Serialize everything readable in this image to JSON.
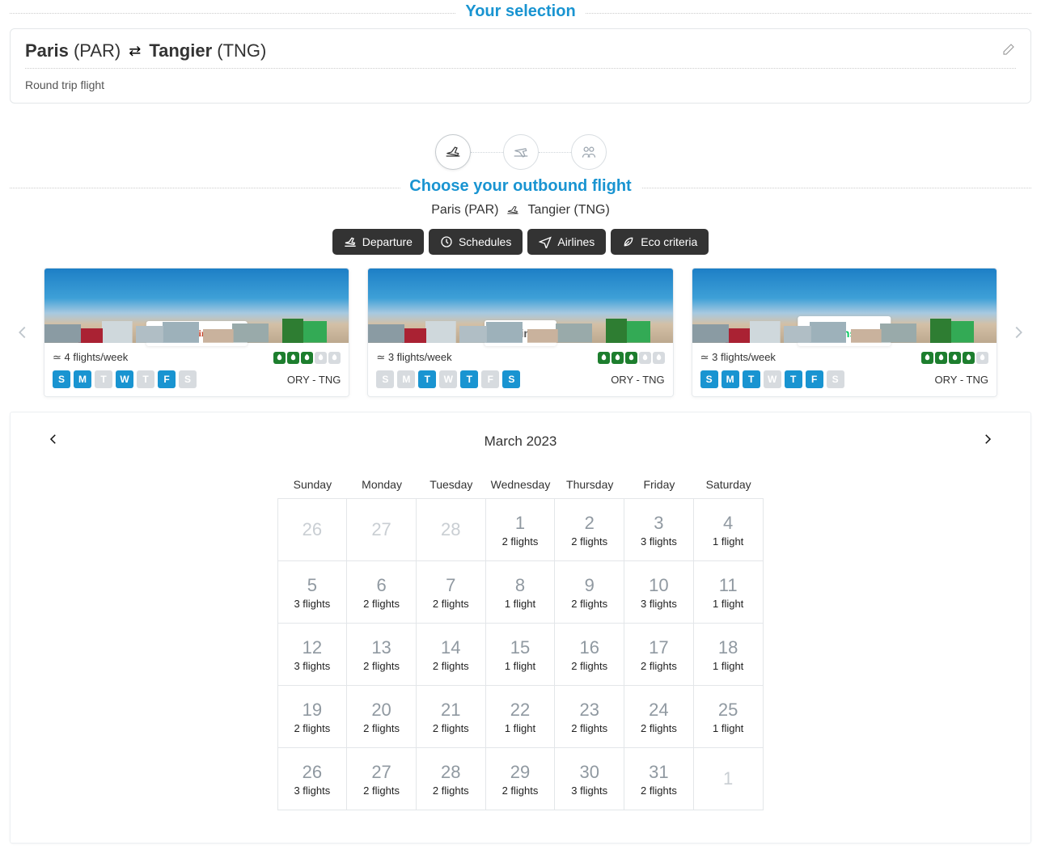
{
  "selection": {
    "title": "Your selection",
    "from_city": "Paris",
    "from_code": "(PAR)",
    "to_city": "Tangier",
    "to_code": "(TNG)",
    "trip_type": "Round trip flight"
  },
  "steps": {
    "active": 0
  },
  "outbound": {
    "title": "Choose your outbound flight",
    "from": "Paris (PAR)",
    "to": "Tangier (TNG)"
  },
  "filters": {
    "departure": "Departure",
    "schedules": "Schedules",
    "airlines": "Airlines",
    "eco": "Eco criteria"
  },
  "day_labels": [
    "S",
    "M",
    "T",
    "W",
    "T",
    "F",
    "S"
  ],
  "airlines": [
    {
      "name": "royal air maroc",
      "logo_class": "logo-ram",
      "freq": "≃ 4 flights/week",
      "eco": [
        true,
        true,
        true,
        false,
        false
      ],
      "days": [
        true,
        true,
        false,
        true,
        false,
        true,
        false
      ],
      "route": "ORY - TNG"
    },
    {
      "name": "vueling",
      "logo_class": "logo-vu",
      "freq": "≃ 3 flights/week",
      "eco": [
        true,
        true,
        true,
        false,
        false
      ],
      "days": [
        false,
        false,
        true,
        false,
        true,
        false,
        true
      ],
      "route": "ORY - TNG"
    },
    {
      "name": "transavia",
      "logo_class": "logo-tr",
      "freq": "≃ 3 flights/week",
      "eco": [
        true,
        true,
        true,
        true,
        false
      ],
      "days": [
        true,
        true,
        true,
        false,
        true,
        true,
        false
      ],
      "route": "ORY - TNG"
    }
  ],
  "calendar": {
    "month": "March 2023",
    "dow": [
      "Sunday",
      "Monday",
      "Tuesday",
      "Wednesday",
      "Thursday",
      "Friday",
      "Saturday"
    ],
    "cells": [
      {
        "n": 26,
        "dim": true
      },
      {
        "n": 27,
        "dim": true
      },
      {
        "n": 28,
        "dim": true
      },
      {
        "n": 1,
        "f": "2 flights"
      },
      {
        "n": 2,
        "f": "2 flights"
      },
      {
        "n": 3,
        "f": "3 flights"
      },
      {
        "n": 4,
        "f": "1 flight"
      },
      {
        "n": 5,
        "f": "3 flights"
      },
      {
        "n": 6,
        "f": "2 flights"
      },
      {
        "n": 7,
        "f": "2 flights"
      },
      {
        "n": 8,
        "f": "1 flight"
      },
      {
        "n": 9,
        "f": "2 flights"
      },
      {
        "n": 10,
        "f": "3 flights"
      },
      {
        "n": 11,
        "f": "1 flight"
      },
      {
        "n": 12,
        "f": "3 flights"
      },
      {
        "n": 13,
        "f": "2 flights"
      },
      {
        "n": 14,
        "f": "2 flights"
      },
      {
        "n": 15,
        "f": "1 flight"
      },
      {
        "n": 16,
        "f": "2 flights"
      },
      {
        "n": 17,
        "f": "2 flights"
      },
      {
        "n": 18,
        "f": "1 flight"
      },
      {
        "n": 19,
        "f": "2 flights"
      },
      {
        "n": 20,
        "f": "2 flights"
      },
      {
        "n": 21,
        "f": "2 flights"
      },
      {
        "n": 22,
        "f": "1 flight"
      },
      {
        "n": 23,
        "f": "2 flights"
      },
      {
        "n": 24,
        "f": "2 flights"
      },
      {
        "n": 25,
        "f": "1 flight"
      },
      {
        "n": 26,
        "f": "3 flights"
      },
      {
        "n": 27,
        "f": "2 flights"
      },
      {
        "n": 28,
        "f": "2 flights"
      },
      {
        "n": 29,
        "f": "2 flights"
      },
      {
        "n": 30,
        "f": "3 flights"
      },
      {
        "n": 31,
        "f": "2 flights"
      },
      {
        "n": 1,
        "dim": true
      }
    ]
  }
}
